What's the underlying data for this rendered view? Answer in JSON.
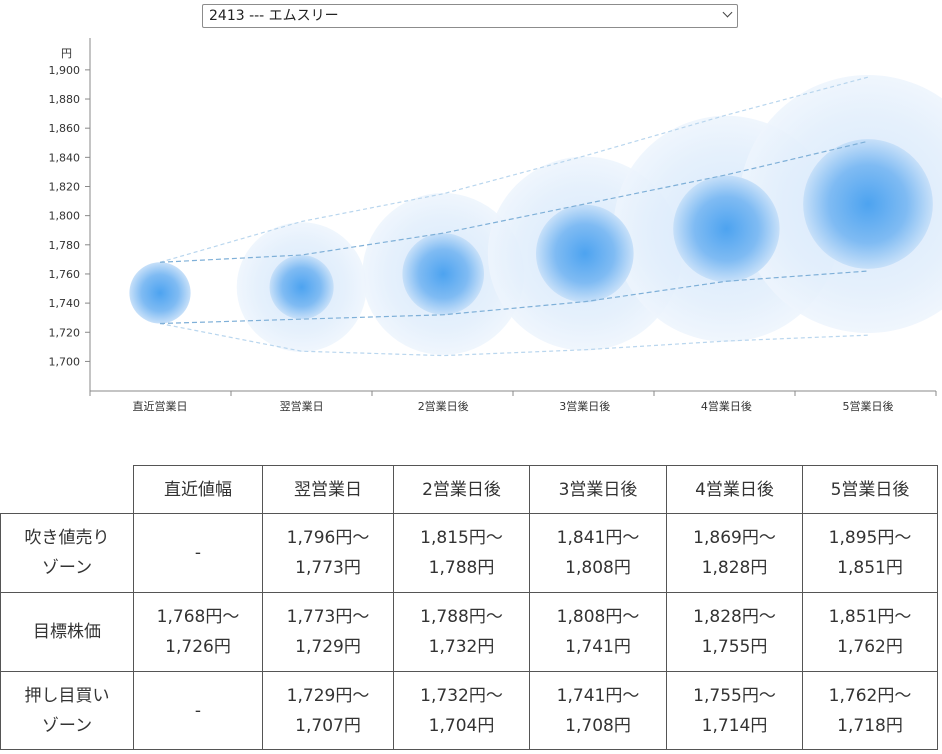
{
  "selector": {
    "value": "2413 --- エムスリー"
  },
  "chart_data": {
    "type": "scatter",
    "ylabel": "円",
    "ylim": [
      1690,
      1915
    ],
    "yticks": [
      "1,700",
      "1,720",
      "1,740",
      "1,760",
      "1,780",
      "1,800",
      "1,820",
      "1,840",
      "1,860",
      "1,880",
      "1,900"
    ],
    "ytick_values": [
      1700,
      1720,
      1740,
      1760,
      1780,
      1800,
      1820,
      1840,
      1860,
      1880,
      1900
    ],
    "categories": [
      "直近営業日",
      "翌営業日",
      "2営業日後",
      "3営業日後",
      "4営業日後",
      "5営業日後"
    ],
    "center": [
      1747,
      1751,
      1760,
      1774,
      1791,
      1808
    ],
    "target_range": {
      "high": [
        1768,
        1773,
        1788,
        1808,
        1828,
        1851
      ],
      "low": [
        1726,
        1729,
        1732,
        1741,
        1755,
        1762
      ]
    },
    "outer_range": {
      "high": [
        1768,
        1796,
        1815,
        1841,
        1869,
        1895
      ],
      "low": [
        1726,
        1707,
        1704,
        1708,
        1714,
        1718
      ]
    },
    "colors": {
      "inner": "#5aa9ee",
      "outer": "#dcecfb",
      "line": "#8ab8dc",
      "axis": "#999999"
    }
  },
  "table": {
    "headers": [
      "",
      "直近値幅",
      "翌営業日",
      "2営業日後",
      "3営業日後",
      "4営業日後",
      "5営業日後"
    ],
    "rows": [
      {
        "label": [
          "吹き値売り",
          "ゾーン"
        ],
        "cells": [
          [
            "-"
          ],
          [
            "1,796円〜",
            "1,773円"
          ],
          [
            "1,815円〜",
            "1,788円"
          ],
          [
            "1,841円〜",
            "1,808円"
          ],
          [
            "1,869円〜",
            "1,828円"
          ],
          [
            "1,895円〜",
            "1,851円"
          ]
        ]
      },
      {
        "label": [
          "目標株価"
        ],
        "cells": [
          [
            "1,768円〜",
            "1,726円"
          ],
          [
            "1,773円〜",
            "1,729円"
          ],
          [
            "1,788円〜",
            "1,732円"
          ],
          [
            "1,808円〜",
            "1,741円"
          ],
          [
            "1,828円〜",
            "1,755円"
          ],
          [
            "1,851円〜",
            "1,762円"
          ]
        ]
      },
      {
        "label": [
          "押し目買い",
          "ゾーン"
        ],
        "cells": [
          [
            "-"
          ],
          [
            "1,729円〜",
            "1,707円"
          ],
          [
            "1,732円〜",
            "1,704円"
          ],
          [
            "1,741円〜",
            "1,708円"
          ],
          [
            "1,755円〜",
            "1,714円"
          ],
          [
            "1,762円〜",
            "1,718円"
          ]
        ]
      }
    ]
  }
}
